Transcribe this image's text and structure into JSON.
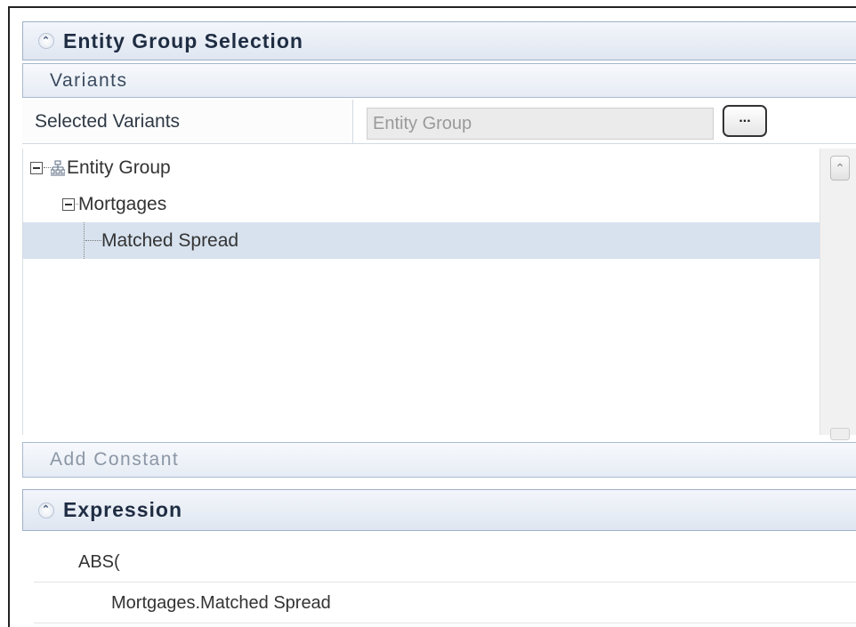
{
  "entity_group_section": {
    "title": "Entity Group Selection",
    "collapse_icon": "double-chevron-up-icon"
  },
  "variants": {
    "header": "Variants",
    "label": "Selected Variants",
    "field_value": "Entity Group",
    "browse_label": "..."
  },
  "tree": {
    "root": "Entity Group",
    "child": "Mortgages",
    "leaf": "Matched Spread"
  },
  "add_constant": {
    "label": "Add Constant"
  },
  "expression_section": {
    "title": "Expression",
    "lines": [
      "ABS(",
      "Mortgages.Matched Spread"
    ]
  },
  "colors": {
    "header_text": "#1f2d43",
    "selection": "#d7e2ee",
    "header_border": "#9fb0c8"
  }
}
